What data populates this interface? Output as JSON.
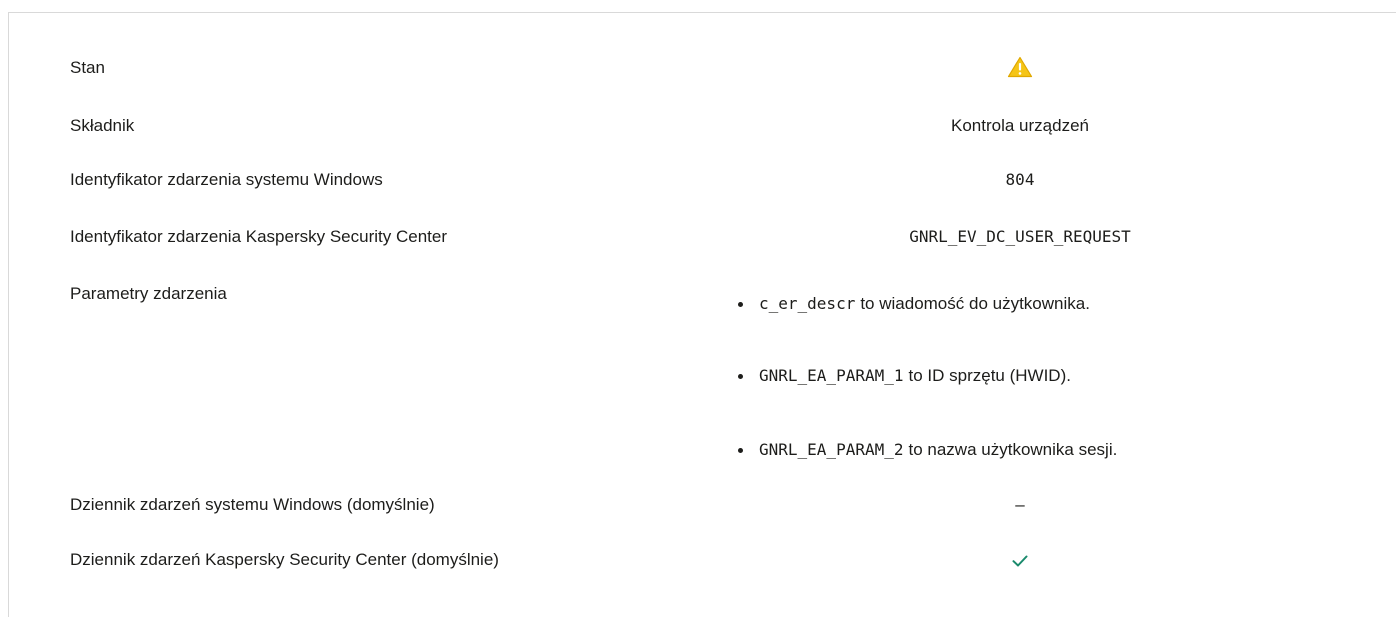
{
  "rows": [
    {
      "label": "Stan",
      "value_icon": "warning-icon",
      "value_icon_color": "#f5c517"
    },
    {
      "label": "Składnik",
      "value": "Kontrola urządzeń"
    },
    {
      "label": "Identyfikator zdarzenia systemu Windows",
      "value": "804"
    },
    {
      "label": "Identyfikator zdarzenia Kaspersky Security Center",
      "value": "GNRL_EV_DC_USER_REQUEST"
    },
    {
      "label": "Parametry zdarzenia",
      "params": [
        {
          "code": "c_er_descr",
          "text": "to wiadomość do użytkownika."
        },
        {
          "code": "GNRL_EA_PARAM_1",
          "text": "to ID sprzętu (HWID)."
        },
        {
          "code": "GNRL_EA_PARAM_2",
          "text": "to nazwa użytkownika sesji."
        }
      ]
    },
    {
      "label": "Dziennik zdarzeń systemu Windows (domyślnie)",
      "value": "–"
    },
    {
      "label": "Dziennik zdarzeń Kaspersky Security Center (domyślnie)",
      "value_icon": "checkmark-icon",
      "value_icon_color": "#1a8a6c"
    }
  ]
}
